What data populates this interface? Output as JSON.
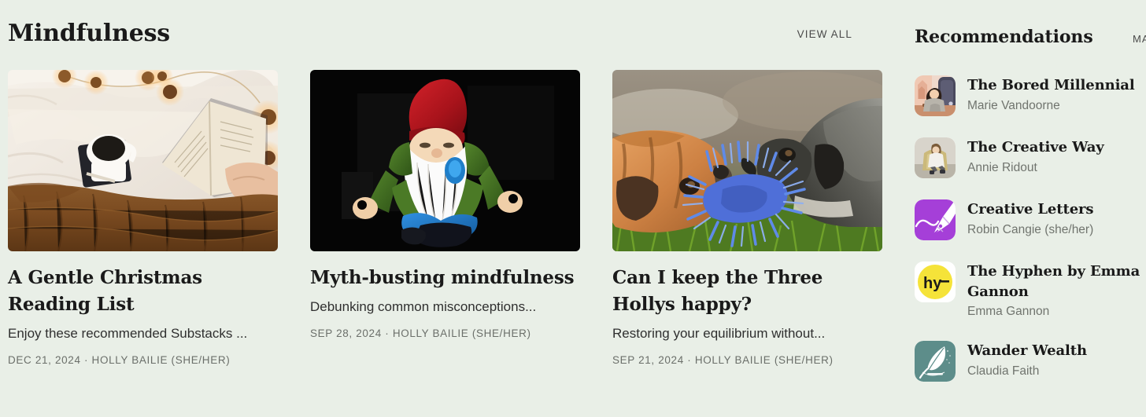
{
  "section": {
    "title": "Mindfulness",
    "view_all_label": "VIEW ALL"
  },
  "posts": [
    {
      "title": "A Gentle Christmas Reading List",
      "subtitle": "Enjoy these recommended Substacks ...",
      "date": "DEC 21, 2024",
      "author": "HOLLY BAILIE (SHE/HER)",
      "meta": "DEC 21, 2024 · HOLLY BAILIE (SHE/HER)",
      "image_alt": "cozy-bed-book-coffee-socks-photo"
    },
    {
      "title": "Myth-busting mindfulness",
      "subtitle": "Debunking common misconceptions...",
      "date": "SEP 28, 2024",
      "author": "HOLLY BAILIE (SHE/HER)",
      "meta": "SEP 28, 2024 · HOLLY BAILIE (SHE/HER)",
      "image_alt": "meditating-garden-gnome-photo"
    },
    {
      "title": "Can I keep the Three Hollys happy?",
      "subtitle": "Restoring your equilibrium without...",
      "date": "SEP 21, 2024",
      "author": "HOLLY BAILIE (SHE/HER)",
      "meta": "SEP 21, 2024 · HOLLY BAILIE (SHE/HER)",
      "image_alt": "two-pugs-tug-of-war-rope-toy-photo"
    }
  ],
  "recommendations": {
    "title": "Recommendations",
    "manage_label": "MA",
    "items": [
      {
        "name": "The Bored Millennial",
        "author": "Marie Vandoorne",
        "avatar": "woman-at-desk-illustration-avatar"
      },
      {
        "name": "The Creative Way",
        "author": "Annie Ridout",
        "avatar": "woman-in-armchair-photo-avatar"
      },
      {
        "name": "Creative Letters",
        "author": "Robin Cangie (she/her)",
        "avatar": "purple-pen-nib-avatar"
      },
      {
        "name": "The Hyphen by Emma Gannon",
        "author": "Emma Gannon",
        "avatar": "yellow-hy-circle-avatar"
      },
      {
        "name": "Wander Wealth",
        "author": "Claudia Faith",
        "avatar": "teal-feather-quill-avatar"
      }
    ]
  },
  "colors": {
    "page_background": "#e9efe7",
    "text_primary": "#1a1a1a",
    "text_muted": "#70746e",
    "creative_letters_purple": "#a53fd8",
    "hyphen_yellow": "#f5e339",
    "wander_wealth_teal": "#5d8d8a"
  }
}
